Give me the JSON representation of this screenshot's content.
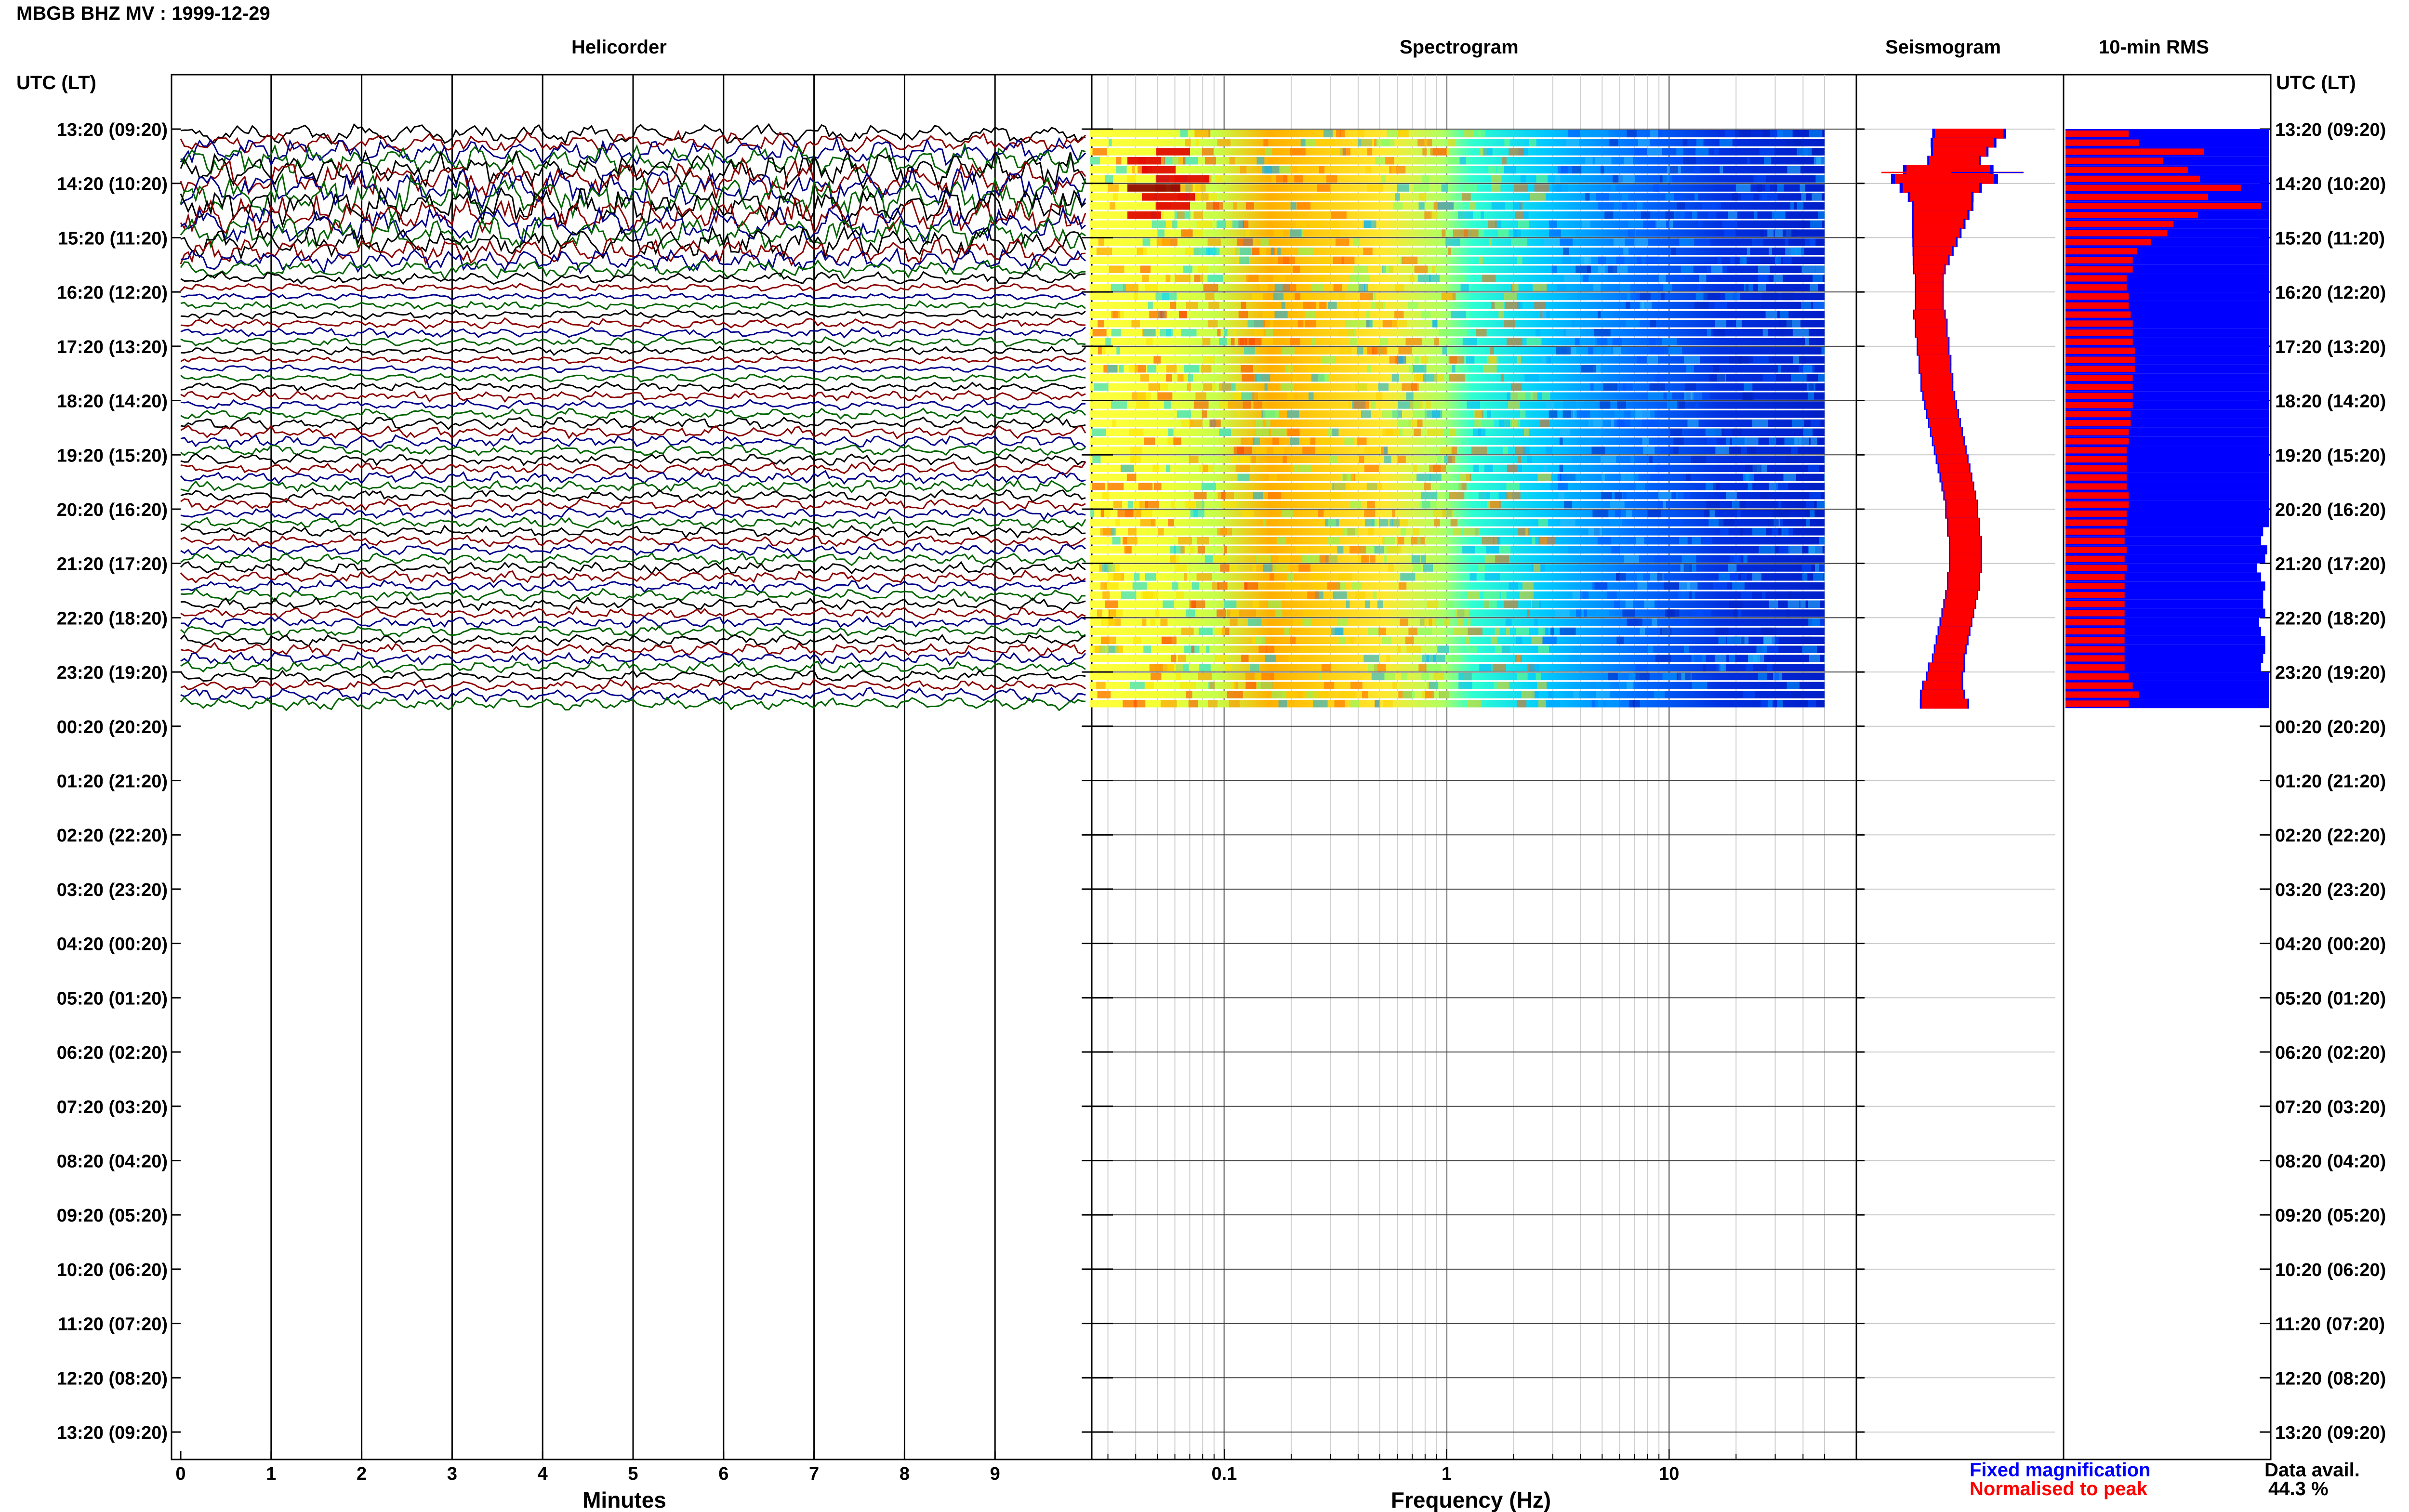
{
  "title": "MBGB BHZ MV : 1999-12-29",
  "panels": {
    "helicorder": "Helicorder",
    "spectrogram": "Spectrogram",
    "seismogram": "Seismogram",
    "rms": "10-min RMS"
  },
  "time_axis": {
    "label": "UTC (LT)",
    "ticks": [
      "13:20 (09:20)",
      "14:20 (10:20)",
      "15:20 (11:20)",
      "16:20 (12:20)",
      "17:20 (13:20)",
      "18:20 (14:20)",
      "19:20 (15:20)",
      "20:20 (16:20)",
      "21:20 (17:20)",
      "22:20 (18:20)",
      "23:20 (19:20)",
      "00:20 (20:20)",
      "01:20 (21:20)",
      "02:20 (22:20)",
      "03:20 (23:20)",
      "04:20 (00:20)",
      "05:20 (01:20)",
      "06:20 (02:20)",
      "07:20 (03:20)",
      "08:20 (04:20)",
      "09:20 (05:20)",
      "10:20 (06:20)",
      "11:20 (07:20)",
      "12:20 (08:20)",
      "13:20 (09:20)"
    ]
  },
  "legend": {
    "fixed": "Fixed magnification",
    "normalised": "Normalised to peak"
  },
  "data_avail": {
    "label": "Data avail.",
    "value": "44.3 %"
  },
  "colors": {
    "trace_cycle": [
      "#000000",
      "#8b0000",
      "#00008b",
      "#006400"
    ],
    "fixed": "#0000ff",
    "normalised": "#ff0000",
    "frame": "#000000"
  },
  "chart_data": [
    {
      "type": "line",
      "title": "Helicorder",
      "xlabel": "Minutes",
      "x_ticks": [
        "0",
        "1",
        "2",
        "3",
        "4",
        "5",
        "6",
        "7",
        "8",
        "9"
      ],
      "xlim": [
        0,
        10
      ],
      "rows_total": 144,
      "rows_with_data": 64,
      "row_amplitude": [
        2.0,
        2.2,
        2.5,
        3.0,
        3.5,
        3.8,
        4.0,
        4.2,
        3.8,
        3.6,
        3.5,
        3.2,
        3.0,
        2.6,
        2.2,
        1.8,
        1.2,
        0.8,
        0.7,
        0.8,
        0.9,
        1.0,
        1.0,
        0.9,
        0.8,
        0.7,
        0.7,
        0.8,
        0.9,
        1.0,
        1.0,
        1.1,
        1.2,
        1.2,
        1.2,
        1.1,
        1.1,
        1.2,
        1.2,
        1.2,
        1.2,
        1.2,
        1.1,
        1.1,
        1.1,
        1.1,
        1.2,
        1.2,
        1.2,
        1.2,
        1.2,
        1.2,
        1.2,
        1.1,
        1.1,
        1.1,
        1.2,
        1.2,
        1.2,
        1.2,
        1.2,
        1.2,
        1.3,
        1.3
      ]
    },
    {
      "type": "heatmap",
      "title": "Spectrogram",
      "xlabel": "Frequency (Hz)",
      "x_scale": "log",
      "x_ticks": [
        "0.1",
        "1",
        "10"
      ],
      "xlim": [
        0.025,
        50
      ],
      "rows_with_data": 64,
      "colormap": "jet"
    },
    {
      "type": "line",
      "title": "Seismogram",
      "series": [
        {
          "name": "Fixed magnification",
          "color": "#0000ff"
        },
        {
          "name": "Normalised to peak",
          "color": "#ff0000"
        }
      ],
      "rows_with_data": 64,
      "row_offset": [
        0.55,
        0.52,
        0.5,
        0.47,
        0.44,
        0.42,
        0.4,
        0.4,
        0.41,
        0.4,
        0.39,
        0.38,
        0.37,
        0.36,
        0.35,
        0.34,
        0.34,
        0.34,
        0.34,
        0.34,
        0.34,
        0.35,
        0.35,
        0.36,
        0.36,
        0.37,
        0.37,
        0.38,
        0.38,
        0.39,
        0.4,
        0.41,
        0.42,
        0.43,
        0.44,
        0.45,
        0.46,
        0.47,
        0.48,
        0.49,
        0.5,
        0.51,
        0.51,
        0.52,
        0.52,
        0.53,
        0.53,
        0.53,
        0.53,
        0.52,
        0.52,
        0.51,
        0.5,
        0.49,
        0.48,
        0.47,
        0.46,
        0.45,
        0.44,
        0.43,
        0.42,
        0.41,
        0.41,
        0.42
      ],
      "row_halfwidth": [
        0.18,
        0.16,
        0.14,
        0.13,
        0.22,
        0.26,
        0.2,
        0.16,
        0.15,
        0.14,
        0.13,
        0.12,
        0.11,
        0.1,
        0.09,
        0.08,
        0.07,
        0.07,
        0.07,
        0.07,
        0.08,
        0.08,
        0.08,
        0.08,
        0.08,
        0.08,
        0.08,
        0.08,
        0.08,
        0.08,
        0.08,
        0.08,
        0.08,
        0.08,
        0.08,
        0.08,
        0.08,
        0.08,
        0.08,
        0.08,
        0.08,
        0.08,
        0.08,
        0.08,
        0.08,
        0.08,
        0.08,
        0.08,
        0.08,
        0.08,
        0.08,
        0.08,
        0.08,
        0.08,
        0.08,
        0.08,
        0.08,
        0.08,
        0.08,
        0.09,
        0.09,
        0.1,
        0.11,
        0.12
      ]
    },
    {
      "type": "bar",
      "title": "10-min RMS",
      "rows_with_data": 64,
      "series": [
        {
          "name": "Fixed magnification",
          "color": "#0000ff",
          "values": [
            1,
            1,
            1,
            1,
            1,
            1,
            1,
            1,
            1,
            1,
            1,
            1,
            1,
            1,
            1,
            1,
            1,
            1,
            1,
            1,
            1,
            1,
            1,
            1,
            1,
            1,
            1,
            1,
            1,
            1,
            1,
            1,
            1,
            1,
            1,
            1,
            1,
            1,
            1,
            1,
            1,
            1,
            1,
            1,
            0.97,
            0.96,
            0.99,
            0.98,
            0.94,
            0.96,
            0.98,
            0.97,
            0.97,
            0.98,
            0.95,
            0.96,
            0.98,
            0.98,
            0.97,
            0.96,
            1,
            1,
            1,
            1
          ]
        },
        {
          "name": "Normalised to peak",
          "color": "#ff0000",
          "values": [
            0.31,
            0.36,
            0.68,
            0.48,
            0.6,
            0.66,
            0.86,
            0.7,
            0.96,
            0.65,
            0.53,
            0.5,
            0.42,
            0.35,
            0.33,
            0.33,
            0.3,
            0.3,
            0.31,
            0.31,
            0.32,
            0.33,
            0.33,
            0.33,
            0.34,
            0.34,
            0.34,
            0.33,
            0.33,
            0.33,
            0.33,
            0.32,
            0.32,
            0.31,
            0.31,
            0.3,
            0.3,
            0.3,
            0.3,
            0.3,
            0.31,
            0.31,
            0.3,
            0.3,
            0.29,
            0.29,
            0.3,
            0.29,
            0.3,
            0.29,
            0.29,
            0.29,
            0.29,
            0.29,
            0.29,
            0.29,
            0.29,
            0.29,
            0.29,
            0.29,
            0.31,
            0.33,
            0.36,
            0.31
          ]
        }
      ]
    }
  ]
}
